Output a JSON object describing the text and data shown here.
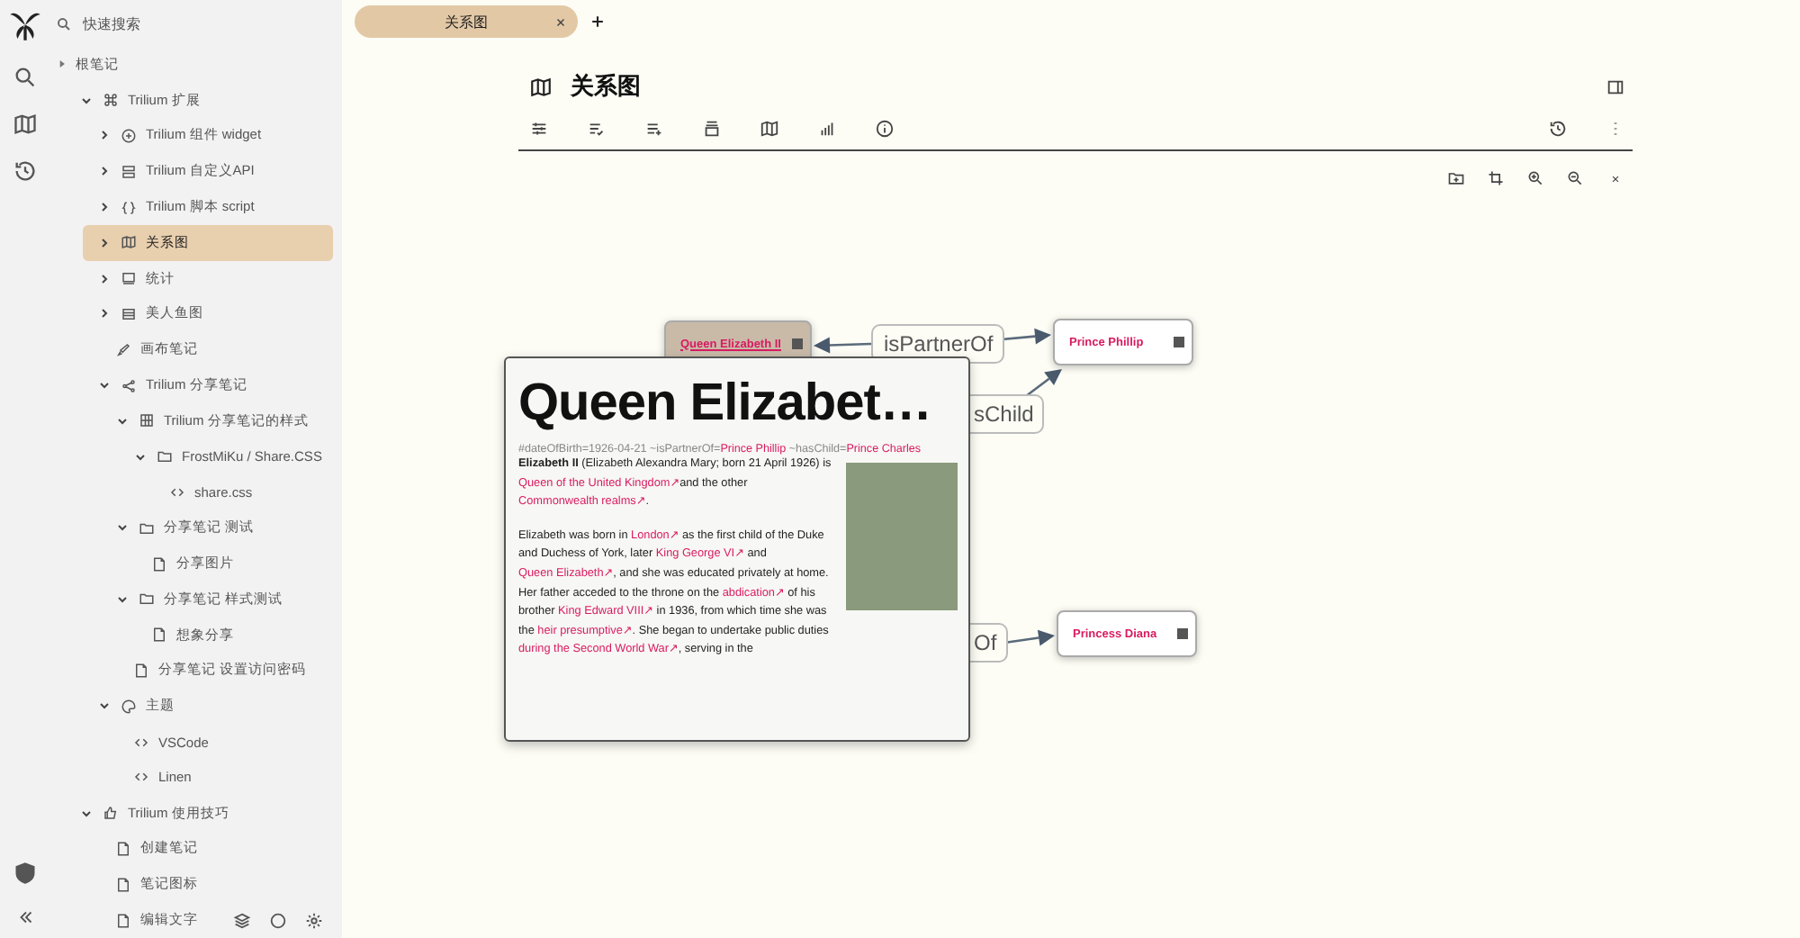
{
  "sidebar": {
    "search": {
      "placeholder": "快速搜索"
    },
    "root": {
      "title": "根笔记"
    },
    "tree": [
      {
        "title": "Trilium 扩展",
        "kind": "command",
        "expanded": true,
        "selected": false,
        "children": [
          {
            "title": "Trilium 组件 widget",
            "kind": "widget",
            "expanded": false,
            "selected": false
          },
          {
            "title": "Trilium 自定义API",
            "kind": "database",
            "expanded": false,
            "selected": false
          },
          {
            "title": "Trilium 脚本 script",
            "kind": "braces",
            "expanded": false,
            "selected": false
          },
          {
            "title": "关系图",
            "kind": "map",
            "expanded": false,
            "selected": true
          },
          {
            "title": "统计",
            "kind": "box",
            "expanded": false,
            "selected": false
          },
          {
            "title": "美人鱼图",
            "kind": "list",
            "expanded": false,
            "selected": false
          },
          {
            "title": "画布笔记",
            "kind": "brush",
            "selected": false
          },
          {
            "title": "Trilium 分享笔记",
            "kind": "share",
            "expanded": true,
            "selected": false,
            "children": [
              {
                "title": "Trilium 分享笔记的样式",
                "kind": "grid",
                "expanded": true,
                "selected": false,
                "children": [
                  {
                    "title": "FrostMiKu / Share.CSS",
                    "kind": "folder",
                    "expanded": true,
                    "selected": false,
                    "children": [
                      {
                        "title": "share.css",
                        "kind": "code",
                        "selected": false
                      }
                    ]
                  }
                ]
              },
              {
                "title": "分享笔记 测试",
                "kind": "folder",
                "expanded": true,
                "selected": false,
                "children": [
                  {
                    "title": "分享图片",
                    "kind": "note",
                    "selected": false
                  }
                ]
              },
              {
                "title": "分享笔记 样式测试",
                "kind": "folder",
                "expanded": true,
                "selected": false,
                "children": [
                  {
                    "title": "想象分享",
                    "kind": "note",
                    "selected": false
                  }
                ]
              },
              {
                "title": "分享笔记 设置访问密码",
                "kind": "note",
                "selected": false
              }
            ]
          },
          {
            "title": "主题",
            "kind": "palette",
            "expanded": true,
            "selected": false,
            "children": [
              {
                "title": "VSCode",
                "kind": "code",
                "selected": false
              },
              {
                "title": "Linen",
                "kind": "code",
                "selected": false
              }
            ]
          }
        ]
      },
      {
        "title": "Trilium 使用技巧",
        "kind": "thumb",
        "expanded": true,
        "selected": false,
        "children": [
          {
            "title": "创建笔记",
            "kind": "note",
            "selected": false
          },
          {
            "title": "笔记图标",
            "kind": "note",
            "selected": false
          },
          {
            "title": "编辑文字",
            "kind": "note",
            "selected": false
          }
        ]
      }
    ]
  },
  "tabs": [
    {
      "title": "关系图",
      "selected": true
    }
  ],
  "note": {
    "title": "关系图"
  },
  "relation_map": {
    "nodes": [
      {
        "title": "Queen Elizabeth II",
        "selected": true
      },
      {
        "title": "Prince Phillip",
        "selected": false
      },
      {
        "title": "Princess Diana",
        "selected": false
      }
    ],
    "edge_labels": [
      "isPartnerOf",
      "sChild",
      "Of"
    ]
  },
  "popup": {
    "title": "Queen Elizabet…",
    "attributes": [
      {
        "kind": "text",
        "text": "#dateOfBirth=1926-04-21 ~isPartnerOf="
      },
      {
        "kind": "link",
        "text": "Prince Phillip"
      },
      {
        "kind": "text",
        "text": " ~hasChild="
      },
      {
        "kind": "link",
        "text": "Prince Charles"
      }
    ],
    "paragraphs": [
      [
        {
          "kind": "text",
          "text": "**Elizabeth II** (Elizabeth Alexandra Mary; born 21 April 1926) is "
        },
        {
          "kind": "link",
          "text": "Queen of the United Kingdom↗"
        },
        {
          "kind": "text",
          "text": "and the other "
        },
        {
          "kind": "link",
          "text": "Commonwealth realms↗"
        },
        {
          "kind": "text",
          "text": "."
        }
      ],
      [
        {
          "kind": "text",
          "text": "Elizabeth was born in "
        },
        {
          "kind": "link",
          "text": "London↗"
        },
        {
          "kind": "text",
          "text": " as the first child of the Duke and Duchess of York, later "
        },
        {
          "kind": "link",
          "text": "King George VI↗"
        },
        {
          "kind": "text",
          "text": " and "
        },
        {
          "kind": "link",
          "text": "Queen Elizabeth↗"
        },
        {
          "kind": "text",
          "text": ", and she was educated privately at home. Her father acceded to the throne on the "
        },
        {
          "kind": "link",
          "text": "abdication↗"
        },
        {
          "kind": "text",
          "text": " of his brother "
        },
        {
          "kind": "link",
          "text": "King Edward VIII↗"
        },
        {
          "kind": "text",
          "text": " in 1936, from which time she was the "
        },
        {
          "kind": "link",
          "text": "heir presumptive↗"
        },
        {
          "kind": "text",
          "text": ". She began to undertake public duties "
        },
        {
          "kind": "link",
          "text": "during the Second World War↗"
        },
        {
          "kind": "text",
          "text": ", serving in the"
        }
      ]
    ]
  }
}
